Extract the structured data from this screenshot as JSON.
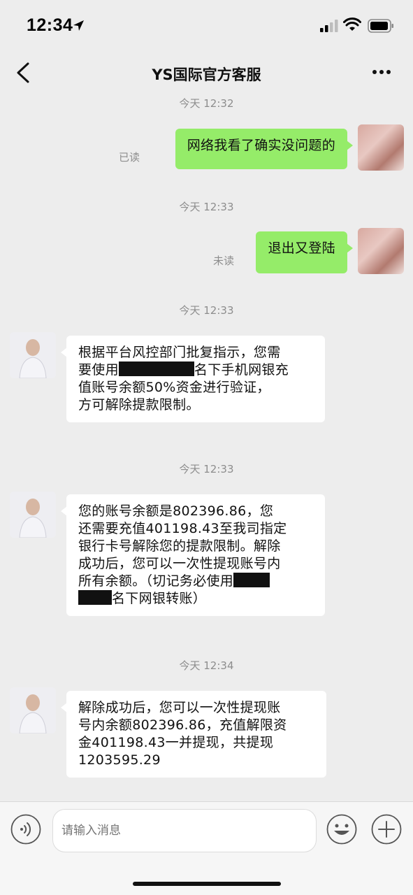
{
  "status_bar": {
    "time": "12:34"
  },
  "nav": {
    "title": "YS国际官方客服"
  },
  "messages": [
    {
      "timestamp": "今天 12:32",
      "sender": "me",
      "status": "已读",
      "text": "网络我看了确实没问题的"
    },
    {
      "timestamp": "今天 12:33",
      "sender": "me",
      "status": "未读",
      "text": "退出又登陆"
    },
    {
      "timestamp": "今天 12:33",
      "sender": "them",
      "lines": [
        "根据平台风控部门批复指示，您需",
        "要使用",
        "名下手机网银充",
        "值账号余额50%资金进行验证，",
        "方可解除提款限制。"
      ]
    },
    {
      "timestamp": "今天 12:33",
      "sender": "them",
      "lines": [
        "您的账号余额是802396.86，您",
        "还需要充值401198.43至我司指定",
        "银行卡号解除您的提款限制。解除",
        "成功后，您可以一次性提现账号内",
        "所有余额。（切记务必使用",
        "名下网银转账）"
      ]
    },
    {
      "timestamp": "今天 12:34",
      "sender": "them",
      "lines": [
        "解除成功后，您可以一次性提现账",
        "号内余额802396.86，充值解限资",
        "金401198.43一并提现，共提现",
        "1203595.29"
      ]
    }
  ],
  "input": {
    "placeholder": "请输入消息"
  },
  "icons": {
    "location": "location-arrow-icon",
    "signal": "cellular-signal-icon",
    "wifi": "wifi-icon",
    "battery": "battery-icon",
    "back": "back-chevron-icon",
    "more": "more-dots-icon",
    "voice": "voice-icon",
    "emoji": "emoji-icon",
    "plus": "plus-icon"
  },
  "colors": {
    "background": "#ededed",
    "my_bubble": "#95ec69",
    "their_bubble": "#ffffff",
    "meta_text": "#8d8d8d"
  }
}
